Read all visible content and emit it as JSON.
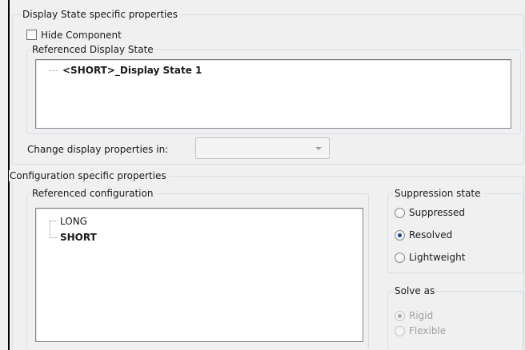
{
  "display_state": {
    "group_title": "Display State specific properties",
    "hide_component_label": "Hide Component",
    "referenced_display_state_title": "Referenced Display State",
    "display_state_items": [
      "<SHORT>_Display State 1"
    ],
    "change_display_label": "Change display properties in:",
    "change_display_value": ""
  },
  "configuration": {
    "group_title": "Configuration specific properties",
    "referenced_configuration_title": "Referenced configuration",
    "configurations": [
      "LONG",
      "SHORT"
    ],
    "suppression": {
      "title": "Suppression state",
      "options": [
        "Suppressed",
        "Resolved",
        "Lightweight"
      ],
      "selected": "Resolved"
    },
    "solve_as": {
      "title": "Solve as",
      "options": [
        "Rigid",
        "Flexible"
      ],
      "selected": "Rigid"
    }
  }
}
